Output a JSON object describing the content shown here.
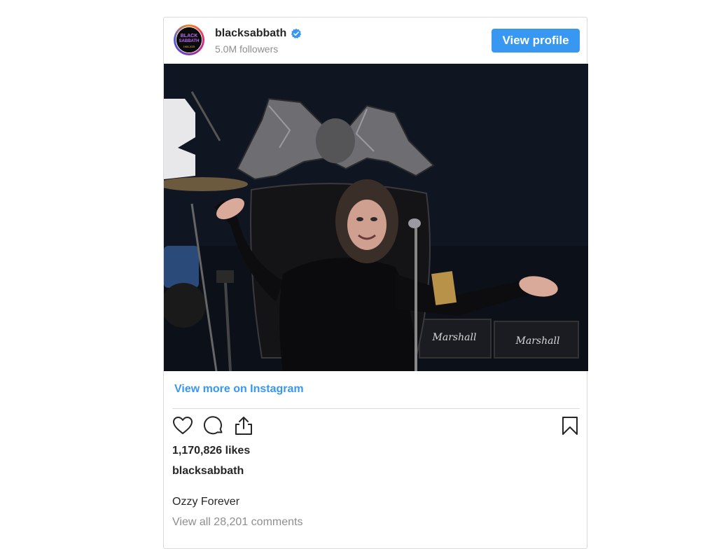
{
  "post": {
    "username": "blacksabbath",
    "followers": "5.0M followers",
    "view_profile_label": "View profile",
    "view_more_label": "View more on Instagram",
    "likes": "1,170,826 likes",
    "caption_user": "blacksabbath",
    "caption_text": "Ozzy Forever",
    "view_comments": "View all 28,201 comments",
    "avatar_text": "BLACK SABBATH",
    "avatar_sub": "1968-2025"
  },
  "photo": {
    "amp_brand": "Marshall"
  },
  "icons": {
    "verified": "verified-badge-icon",
    "like": "heart-icon",
    "comment": "comment-icon",
    "share": "share-icon",
    "save": "bookmark-icon"
  },
  "colors": {
    "accent": "#3897f0",
    "text": "#262626",
    "muted": "#8e8e8e",
    "border": "#dbdbdb"
  }
}
